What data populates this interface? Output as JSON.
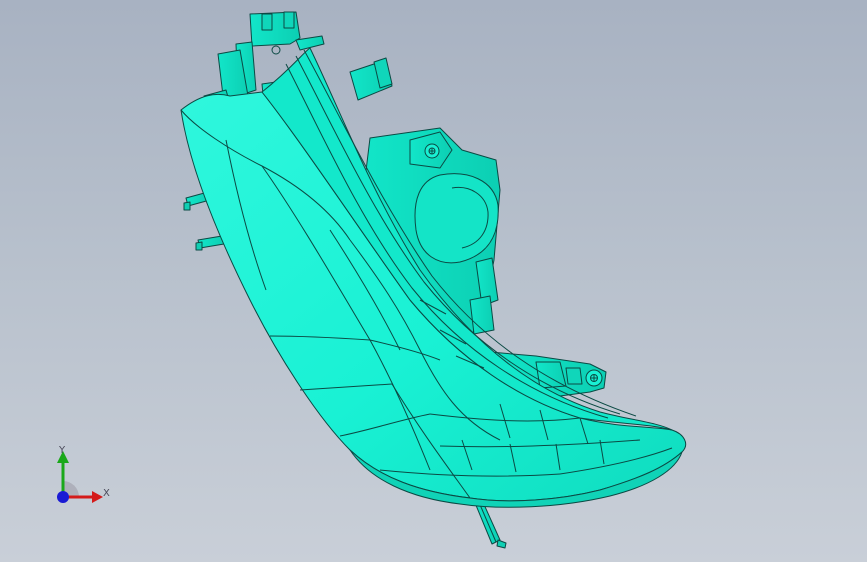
{
  "viewport": {
    "background_top": "#a8b2c2",
    "background_bottom": "#c9cfd8",
    "model_color": "#19f5d7",
    "model_shade": "#0fd9bd",
    "edge_color": "#0b4a44"
  },
  "model": {
    "icon": "headlamp-housing-3d-model"
  },
  "triad": {
    "x_label": "X",
    "y_label": "Y",
    "x_color": "#d41a1a",
    "y_color": "#1aa81a",
    "z_color": "#1a1ad4"
  }
}
